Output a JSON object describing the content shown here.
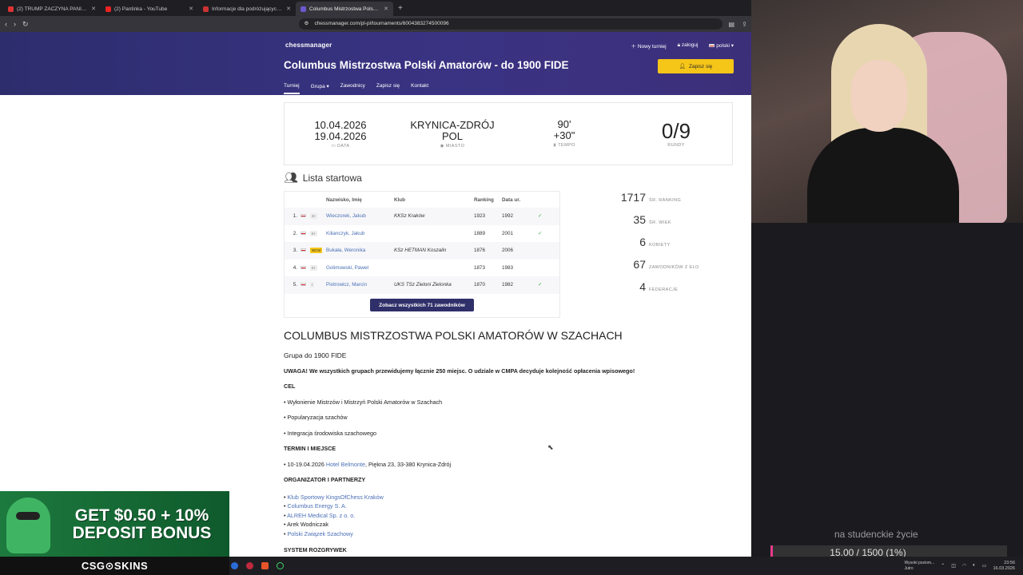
{
  "browser": {
    "tabs": [
      {
        "title": "(2) TRUMP ZACZYNA PANIKOWAĆ! | ...",
        "color": "#d33"
      },
      {
        "title": "(2) Pantinka - YouTube",
        "color": "#e22"
      },
      {
        "title": "Informacje dla podróżujących - Polsk...",
        "color": "#c33"
      },
      {
        "title": "Columbus Mistrzostwa Polski Am...",
        "color": "#6a5acd"
      }
    ],
    "url": "chessmanager.com/pl-pl/tournaments/6004383274500096"
  },
  "header": {
    "logo": "chess​manager",
    "new_tournament": "Nowy turniej",
    "login": "zaloguj",
    "language": "polski",
    "title": "Columbus Mistrzostwa Polski Amatorów - do 1900 FIDE",
    "signup": "Zapisz się",
    "nav": [
      "Turniej",
      "Grupa",
      "Zawodnicy",
      "Zapisz się",
      "Kontakt"
    ]
  },
  "info": {
    "date_start": "10.04.2026",
    "date_end": "19.04.2026",
    "date_label": "DATA",
    "city_line1": "KRYNICA-ZDRÓJ",
    "city_line2": "POL",
    "city_label": "MIASTO",
    "tempo_line1": "90'",
    "tempo_line2": "+30\"",
    "tempo_label": "TEMPO",
    "rounds": "0/9",
    "rounds_label": "RUNDY"
  },
  "startlist": {
    "title": "Lista startowa",
    "headers": {
      "name": "Nazwisko, Imię",
      "club": "Klub",
      "ranking": "Ranking",
      "born": "Data ur."
    },
    "rows": [
      {
        "num": "1.",
        "title": "3+",
        "name": "Wieczorek, Jakub",
        "club": "KKSz Kraków",
        "ranking": "1923",
        "born": "1992",
        "ok": "✓"
      },
      {
        "num": "2.",
        "title": "II+",
        "name": "Kilianczyk, Jakub",
        "club": "",
        "ranking": "1889",
        "born": "2001",
        "ok": "✓"
      },
      {
        "num": "3.",
        "title": "WCM",
        "name": "Bukała, Weronika",
        "club": "KSz HETMAN Koszalin",
        "ranking": "1876",
        "born": "2006",
        "ok": ""
      },
      {
        "num": "4.",
        "title": "II+",
        "name": "Golimowski, Paweł",
        "club": "",
        "ranking": "1873",
        "born": "1983",
        "ok": ""
      },
      {
        "num": "5.",
        "title": "I",
        "name": "Piotrowicz, Marcin",
        "club": "UKS TSz Zieloni Zielonka",
        "ranking": "1870",
        "born": "1982",
        "ok": "✓"
      }
    ],
    "see_all": "Zobacz wszystkich 71 zawodników"
  },
  "stats": [
    {
      "n": "1717",
      "l": "ŚR. RANKING"
    },
    {
      "n": "35",
      "l": "ŚR. WIEK"
    },
    {
      "n": "6",
      "l": "KOBIETY"
    },
    {
      "n": "67",
      "l": "ZAWODNIKÓW Z ELO"
    },
    {
      "n": "4",
      "l": "FEDERACJE"
    }
  ],
  "description": {
    "heading": "COLUMBUS MISTRZOSTWA POLSKI AMATORÓW W SZACHACH",
    "group": "Grupa do 1900 FIDE",
    "warning": "UWAGA! We wszystkich grupach przewidujemy łącznie 250 miejsc. O udziale w CMPA decyduje kolejność opłacenia wpisowego!",
    "goal_h": "CEL",
    "goals": [
      "• Wyłonienie Mistrzów i Mistrzyń Polski Amatorów w Szachach",
      "• Popularyzacja szachów",
      "• Integracja środowiska szachowego"
    ],
    "place_h": "TERMIN I MIEJSCE",
    "place_prefix": "• 10-19.04.2026 ",
    "place_link": "Hotel Belmonte",
    "place_suffix": ", Piękna 23, 33-380 Krynica-Zdrój",
    "org_h": "ORGANIZATOR I PARTNERZY",
    "orgs": [
      {
        "text": "Klub Sportowy KingsOfChess Kraków",
        "link": true
      },
      {
        "text": "Columbus Energy S. A.",
        "link": true
      },
      {
        "text": "ALREH Medical Sp. z o. o.",
        "link": true
      },
      {
        "text": "Arek Wodniczak",
        "link": false
      },
      {
        "text": "Polski Związek Szachowy",
        "link": true
      }
    ],
    "system_h": "SYSTEM ROZGRYWEK"
  },
  "ad": {
    "line1": "GET $0.50 + 10%",
    "line2": "DEPOSIT BONUS",
    "brand": "CSG⊙SKINS"
  },
  "overlay": {
    "caption": "na studenckie życie",
    "goal": "15.00 / 1500 (1%)",
    "goal_progress": 0.01
  },
  "taskbar": {
    "weather_l1": "Wysoki poziom...",
    "weather_l2": "Jutro",
    "time": "23:56",
    "date": "16.03.2026"
  }
}
